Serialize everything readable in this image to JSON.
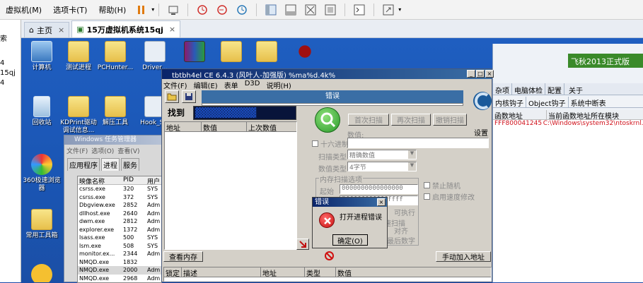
{
  "menubar": {
    "items": [
      "虚拟机(M)",
      "选项卡(T)",
      "帮助(H)"
    ]
  },
  "tabs": {
    "home": "主页",
    "vm": "15万虚拟机系统15qj"
  },
  "sidepanel": {
    "items": [
      "索",
      "4",
      "15qj",
      "4"
    ]
  },
  "desktop": {
    "icons": [
      {
        "label": "计算机"
      },
      {
        "label": "测试进程"
      },
      {
        "label": "PCHunter..."
      },
      {
        "label": "Driver..."
      },
      {
        "label": "回收站"
      },
      {
        "label": "KDPrint驱动调试信息..."
      },
      {
        "label": "解压工具"
      },
      {
        "label": "Hook_S..."
      },
      {
        "label": "360极速浏览器"
      },
      {
        "label": "常用工具箱"
      }
    ]
  },
  "taskmgr": {
    "title": "Windows 任务管理器",
    "menu": [
      "文件(F)",
      "选项(O)",
      "查看(V)"
    ],
    "tabs": [
      "应用程序",
      "进程",
      "服务"
    ],
    "columns": [
      "映像名称",
      "PID",
      "用户"
    ],
    "rows": [
      [
        "csrss.exe",
        "320",
        "SYS"
      ],
      [
        "csrss.exe",
        "372",
        "SYS"
      ],
      [
        "Dbgview.exe",
        "2852",
        "Adm"
      ],
      [
        "dllhost.exe",
        "2640",
        "Adm"
      ],
      [
        "dwm.exe",
        "2812",
        "Adm"
      ],
      [
        "explorer.exe",
        "1372",
        "Adm"
      ],
      [
        "lsass.exe",
        "500",
        "SYS"
      ],
      [
        "lsm.exe",
        "508",
        "SYS"
      ],
      [
        "monitor.ex...",
        "2344",
        "Adm"
      ],
      [
        "NMQD.exe",
        "1832",
        ""
      ],
      [
        "NMQD.exe",
        "2000",
        "Adm"
      ],
      [
        "NMQD.exe",
        "2968",
        "Adm"
      ]
    ]
  },
  "ce": {
    "title": "tbtbh4el CE 6.4.3 (风叶人-加强版) %ma%d.4k%",
    "menu": [
      "文件(F)",
      "编辑(E)",
      "表单",
      "D3D",
      "说明(H)"
    ],
    "process_label": "错误",
    "found_label": "找到",
    "list_columns": [
      "地址",
      "数值",
      "上次数值"
    ],
    "first_scan": "首次扫描",
    "next_scan": "再次扫描",
    "undo_scan": "撤销扫描",
    "settings": "设置",
    "value_label": "数值:",
    "hex_label": "十六进制",
    "scan_type_label": "扫描类型",
    "scan_type_value": "精确数值",
    "value_type_label": "数值类型",
    "value_type_value": "4字节",
    "mem_scan_label": "内存扫描选项",
    "start_label": "起始",
    "start_value": "0000000000000000",
    "stop_value": "7fffffffffffffff",
    "executable": "可执行",
    "fast_scan": "快速扫描",
    "align": "对齐",
    "last_digits": "最后数字",
    "disable_random": "禁止随机",
    "enable_speedhack": "启用速度修改",
    "view_memory": "查看内存",
    "add_address": "手动加入地址",
    "table_columns": [
      "锁定",
      "描述",
      "地址",
      "类型",
      "数值"
    ]
  },
  "errdialog": {
    "title": "错误",
    "message": "打开进程错误",
    "ok": "确定(O)"
  },
  "rightwin": {
    "toptabs": [
      "杂项",
      "电脑体检",
      "配置",
      "关于"
    ],
    "brand": "飞秋2013正式版",
    "subtabs": [
      "内核钩子",
      "Object钩子",
      "系统中断表"
    ],
    "columns": [
      "函数地址",
      "当前函数地址所在模块"
    ],
    "row": [
      "FFF800041245F8",
      "C:\\Windows\\system32\\ntoskrnl.exe"
    ]
  }
}
